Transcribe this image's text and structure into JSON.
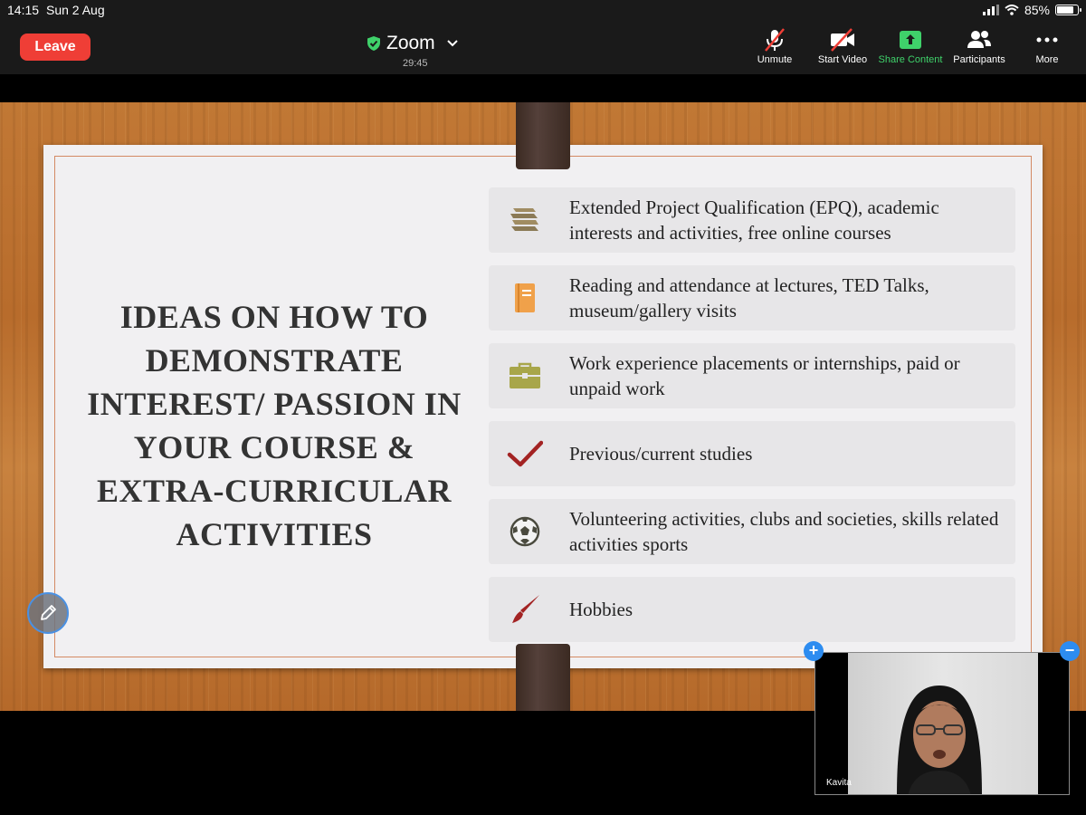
{
  "status_bar": {
    "time": "14:15",
    "date": "Sun 2 Aug",
    "battery": "85%",
    "battery_level": 0.85
  },
  "toolbar": {
    "leave_label": "Leave",
    "app_title": "Zoom",
    "meeting_timer": "29:45",
    "buttons": [
      {
        "label": "Unmute",
        "icon": "mic-muted-icon"
      },
      {
        "label": "Start Video",
        "icon": "video-off-icon"
      },
      {
        "label": "Share Content",
        "icon": "share-up-arrow-icon"
      },
      {
        "label": "Participants",
        "icon": "participants-icon"
      },
      {
        "label": "More",
        "icon": "more-dots-icon"
      }
    ],
    "colors": {
      "leave": "#ef3e36",
      "share_content": "#3fd16a",
      "shield": "#3fd16a"
    }
  },
  "slide": {
    "title": "IDEAS ON HOW TO DEMONSTRATE INTEREST/ PASSION IN YOUR COURSE & EXTRA-CURRICULAR ACTIVITIES",
    "items": [
      {
        "icon": "books-icon",
        "text": "Extended Project Qualification (EPQ), academic interests and activities, free online courses"
      },
      {
        "icon": "book-icon",
        "text": "Reading and attendance at lectures, TED Talks, museum/gallery visits"
      },
      {
        "icon": "briefcase-icon",
        "text": "Work experience placements or internships, paid or unpaid work"
      },
      {
        "icon": "checkmark-icon",
        "text": "Previous/current studies"
      },
      {
        "icon": "soccer-ball-icon",
        "text": "Volunteering activities, clubs and societies, skills related activities sports"
      },
      {
        "icon": "paintbrush-icon",
        "text": "Hobbies"
      }
    ]
  },
  "video_tile": {
    "participant_name": "Kavita",
    "expand_symbol": "+",
    "collapse_symbol": "−"
  }
}
